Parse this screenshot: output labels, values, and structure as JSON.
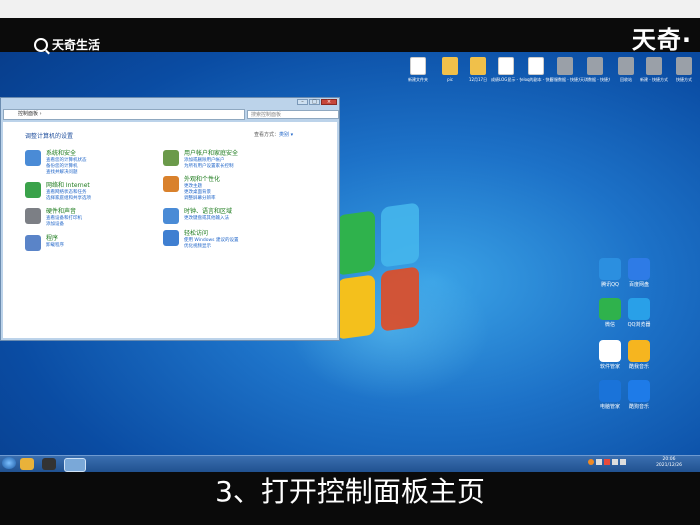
{
  "brand": {
    "logo_text": "天奇生活",
    "watermark": "天奇·"
  },
  "caption": "3、打开控制面板主页",
  "desktop_icons": [
    {
      "label": "新建文件夹",
      "kind": "doc"
    },
    {
      "label": "pic",
      "kind": "folder"
    },
    {
      "label": "12月17日",
      "kind": "folder"
    },
    {
      "label": "成绩LOG显示 - 快捷方式",
      "kind": "doc"
    },
    {
      "label": "eloq的副本 - 快捷方式",
      "kind": "doc"
    },
    {
      "label": "客服数据 - 快捷方式",
      "kind": "gray"
    },
    {
      "label": "天琪数据 - 快捷方式",
      "kind": "gray"
    },
    {
      "label": "回收站",
      "kind": "gray"
    },
    {
      "label": "新建 - 快捷方式",
      "kind": "gray"
    },
    {
      "label": "快捷方式",
      "kind": "gray"
    }
  ],
  "right_apps": [
    {
      "label": "腾讯QQ",
      "color": "#2b8fe0"
    },
    {
      "label": "百度网盘",
      "color": "#2e7be6"
    },
    {
      "label": "微信",
      "color": "#2fb24c"
    },
    {
      "label": "QQ浏览器",
      "color": "#29a0e8"
    },
    {
      "label": "软件管家",
      "color": "#ffffff"
    },
    {
      "label": "酷我音乐",
      "color": "#f6b51f"
    },
    {
      "label": "电脑管家",
      "color": "#1a73d9"
    },
    {
      "label": "酷狗音乐",
      "color": "#1e7be8"
    }
  ],
  "window": {
    "address": "控制面板 ›",
    "search_placeholder": "搜索控制面板",
    "heading": "调整计算机的设置",
    "view_by_label": "查看方式：",
    "view_by_value": "类别 ▾",
    "categories": [
      {
        "name": "系统和安全",
        "links": [
          "查看您的计算机状态",
          "备份您的计算机",
          "查找并解决问题"
        ],
        "color": "#4a8bd6"
      },
      {
        "name": "网络和 Internet",
        "links": [
          "查看网络状态和任务",
          "选择家庭组和共享选项"
        ],
        "color": "#3aa24a"
      },
      {
        "name": "硬件和声音",
        "links": [
          "查看设备和打印机",
          "添加设备"
        ],
        "color": "#7c7f85"
      },
      {
        "name": "程序",
        "links": [
          "卸载程序"
        ],
        "color": "#5a84c8"
      },
      {
        "name": "用户帐户和家庭安全",
        "links": [
          "添加或删除用户帐户",
          "为所有用户设置家长控制"
        ],
        "color": "#6b9a4a"
      },
      {
        "name": "外观和个性化",
        "links": [
          "更改主题",
          "更改桌面背景",
          "调整屏幕分辨率"
        ],
        "color": "#d9812c"
      },
      {
        "name": "时钟、语言和区域",
        "links": [
          "更改键盘或其他输入法"
        ],
        "color": "#4a8bd6"
      },
      {
        "name": "轻松访问",
        "links": [
          "使用 Windows 建议的设置",
          "优化视频显示"
        ],
        "color": "#3f7fd1"
      }
    ]
  },
  "taskbar": {
    "clock_time": "20:06",
    "clock_date": "2021/12/26",
    "items": [
      "ie",
      "explorer",
      "qq",
      "control-panel"
    ]
  }
}
